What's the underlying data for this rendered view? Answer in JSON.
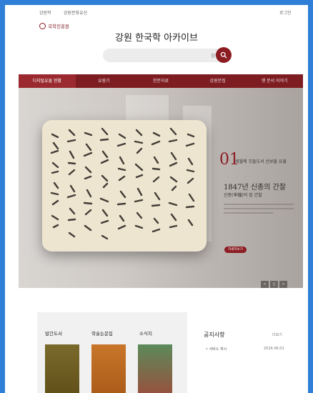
{
  "top_links": [
    "강원학",
    "강원문화유산"
  ],
  "login_label": "로그인",
  "logo_text": "국학진흥원",
  "site_title": "강원 한국학 아카이브",
  "search": {
    "shortcut": "검색"
  },
  "nav": [
    {
      "label": "디지털유물 현황",
      "active": true
    },
    {
      "label": "유람기",
      "active": false
    },
    {
      "label": "한문자료",
      "active": false
    },
    {
      "label": "강원문집",
      "active": false
    },
    {
      "label": "옛 문서 이야기",
      "active": false
    }
  ],
  "hero": {
    "number": "01",
    "subtitle": "세월에 깃들도서 선보물 유물",
    "heading": "1847년 신종의 간찰",
    "author": "신종(申鐘)의 집 간찰",
    "more_label": "자세히보기",
    "pager": [
      "<",
      "||",
      ">"
    ]
  },
  "sections": {
    "publications": "발간도서",
    "papers": "학술논문집",
    "journal": "소식지",
    "notices": "공지사항",
    "notices_more": "더보기",
    "notice_item": "• 서비스 개시",
    "notice_date": "2024.06.01"
  },
  "colors": {
    "brand": "#8b1c22",
    "frame": "#2f7fd8"
  }
}
